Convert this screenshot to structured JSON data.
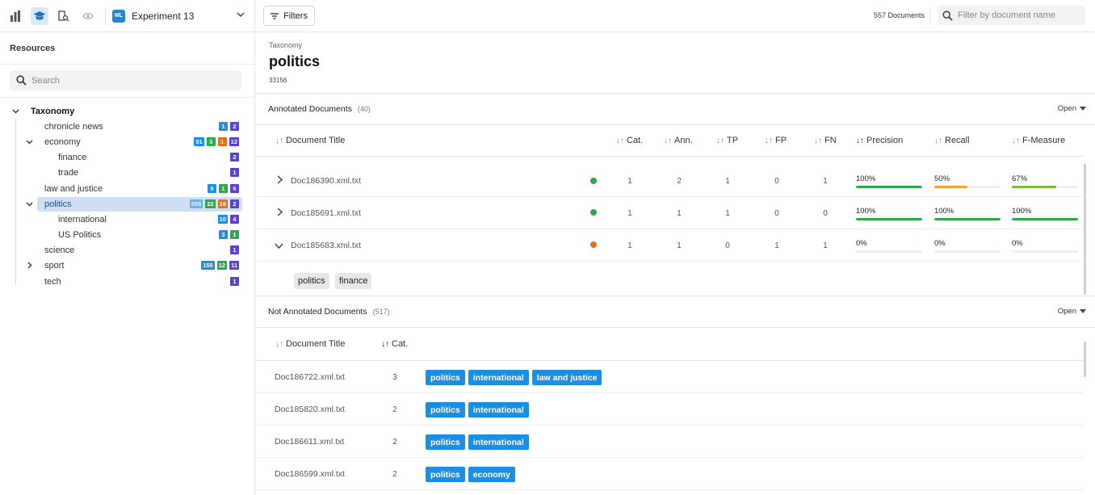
{
  "toolbar": {
    "experiment_badge": "ML",
    "experiment_name": "Experiment 13"
  },
  "sidebar": {
    "title": "Resources",
    "search_placeholder": "Search",
    "tree": {
      "root_label": "Taxonomy",
      "nodes": [
        {
          "label": "chronicle news",
          "badges": [
            "1",
            "2"
          ]
        },
        {
          "label": "economy",
          "badges": [
            "91",
            "3",
            "1",
            "12"
          ]
        },
        {
          "label": "finance",
          "badges": [
            "2"
          ]
        },
        {
          "label": "trade",
          "badges": [
            "1"
          ]
        },
        {
          "label": "law and justice",
          "badges": [
            "9",
            "1",
            "6"
          ]
        },
        {
          "label": "politics",
          "badges": [
            "555",
            "22",
            "16",
            "2"
          ]
        },
        {
          "label": "international",
          "badges": [
            "10",
            "4"
          ]
        },
        {
          "label": "US Politics",
          "badges": [
            "3",
            "1"
          ]
        },
        {
          "label": "science",
          "badges": [
            "1"
          ]
        },
        {
          "label": "sport",
          "badges": [
            "155",
            "12",
            "11"
          ]
        },
        {
          "label": "tech",
          "badges": [
            "1"
          ]
        }
      ]
    },
    "badge_colors": {
      "blue": "#1a8fe3",
      "green": "#2ea84f",
      "orange": "#ea6d1c",
      "purple": "#5b3fd6"
    }
  },
  "main": {
    "filters_label": "Filters",
    "document_count": "557 Documents",
    "filter_placeholder": "Filter by document name",
    "header": {
      "breadcrumb": "Taxonomy",
      "title": "politics",
      "id": "33156"
    },
    "annotated": {
      "title": "Annotated Documents",
      "count": "(40)",
      "open_label": "Open",
      "columns": {
        "title": "Document Title",
        "cat": "Cat.",
        "ann": "Ann.",
        "tp": "TP",
        "fp": "FP",
        "fn": "FN",
        "precision": "Precision",
        "recall": "Recall",
        "fmeasure": "F-Measure"
      },
      "rows": [
        {
          "name": "Doc186390.xml.txt",
          "status": "green",
          "cat": "1",
          "ann": "2",
          "tp": "1",
          "fp": "0",
          "fn": "1",
          "precision": "100%",
          "recall": "50%",
          "fmeasure": "67%"
        },
        {
          "name": "Doc185691.xml.txt",
          "status": "green",
          "cat": "1",
          "ann": "1",
          "tp": "1",
          "fp": "0",
          "fn": "0",
          "precision": "100%",
          "recall": "100%",
          "fmeasure": "100%"
        },
        {
          "name": "Doc185683.xml.txt",
          "status": "orange",
          "cat": "1",
          "ann": "1",
          "tp": "0",
          "fp": "1",
          "fn": "1",
          "precision": "0%",
          "recall": "0%",
          "fmeasure": "0%"
        }
      ],
      "expanded_tags": [
        "politics",
        "finance"
      ]
    },
    "not_annotated": {
      "title": "Not Annotated Documents",
      "count": "(517)",
      "open_label": "Open",
      "columns": {
        "title": "Document Title",
        "cat": "Cat."
      },
      "rows": [
        {
          "name": "Doc186722.xml.txt",
          "cat": "3",
          "tags": [
            "politics",
            "international",
            "law and justice"
          ]
        },
        {
          "name": "Doc185820.xml.txt",
          "cat": "2",
          "tags": [
            "politics",
            "international"
          ]
        },
        {
          "name": "Doc186611.xml.txt",
          "cat": "2",
          "tags": [
            "politics",
            "international"
          ]
        },
        {
          "name": "Doc186599.xml.txt",
          "cat": "2",
          "tags": [
            "politics",
            "economy"
          ]
        }
      ]
    }
  },
  "colors": {
    "green": "#2ea84f",
    "orange": "#f0a035",
    "dot_green": "#2ea84f",
    "dot_orange": "#ea6d1c",
    "selected": "#cfe0f5",
    "accent": "#1a8fe3"
  }
}
